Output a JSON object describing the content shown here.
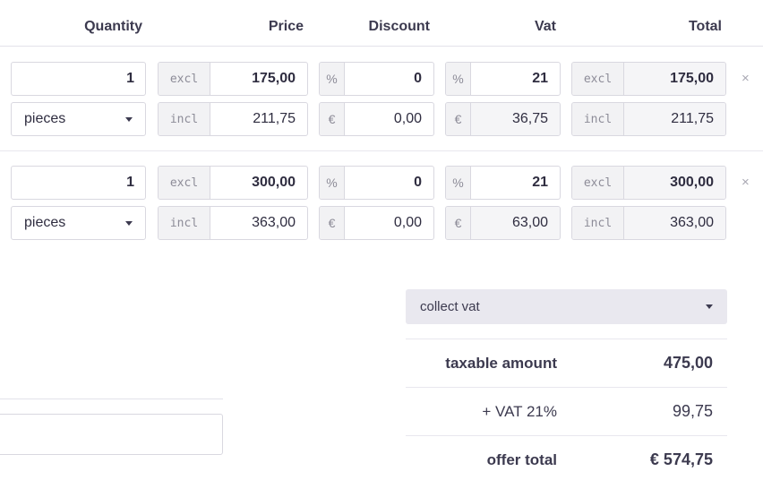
{
  "headers": {
    "quantity": "Quantity",
    "price": "Price",
    "discount": "Discount",
    "vat": "Vat",
    "total": "Total"
  },
  "lines": [
    {
      "quantity": "1",
      "unit": "pieces",
      "price_excl_tag": "excl",
      "price_excl": "175,00",
      "price_incl_tag": "incl",
      "price_incl": "211,75",
      "discount_pct_sym": "%",
      "discount_pct": "0",
      "discount_amt_sym": "€",
      "discount_amt": "0,00",
      "vat_pct_sym": "%",
      "vat_pct": "21",
      "vat_amt_sym": "€",
      "vat_amt": "36,75",
      "total_excl_tag": "excl",
      "total_excl": "175,00",
      "total_incl_tag": "incl",
      "total_incl": "211,75",
      "remove": "×"
    },
    {
      "quantity": "1",
      "unit": "pieces",
      "price_excl_tag": "excl",
      "price_excl": "300,00",
      "price_incl_tag": "incl",
      "price_incl": "363,00",
      "discount_pct_sym": "%",
      "discount_pct": "0",
      "discount_amt_sym": "€",
      "discount_amt": "0,00",
      "vat_pct_sym": "%",
      "vat_pct": "21",
      "vat_amt_sym": "€",
      "vat_amt": "63,00",
      "total_excl_tag": "excl",
      "total_excl": "300,00",
      "total_incl_tag": "incl",
      "total_incl": "363,00",
      "remove": "×"
    }
  ],
  "vat_mode": "collect vat",
  "totals": {
    "taxable_label": "taxable amount",
    "taxable_value": "475,00",
    "vat_label": "+ VAT 21%",
    "vat_value": "99,75",
    "offer_label": "offer total",
    "offer_value": "€ 574,75"
  },
  "colors": {
    "text": "#3c3a4f",
    "border": "#d9d8e0",
    "addon_bg": "#f2f2f4",
    "select_bg": "#e9e8ef"
  }
}
